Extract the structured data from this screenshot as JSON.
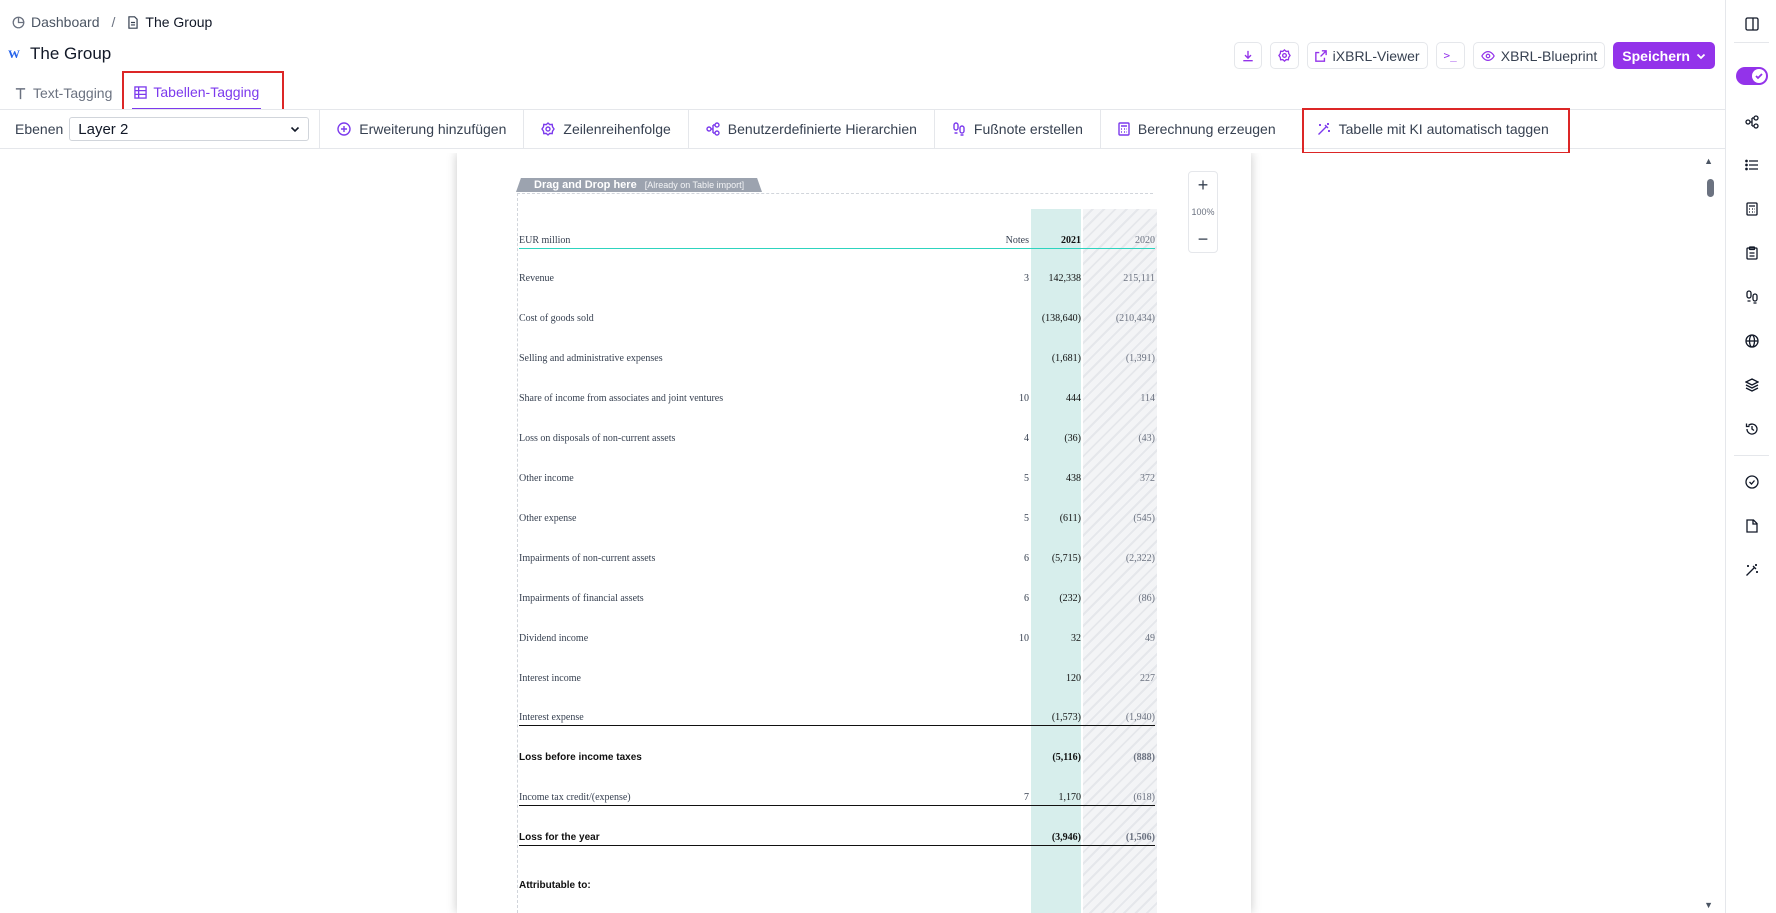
{
  "breadcrumb": {
    "home": "Dashboard",
    "separator": "/",
    "current": "The Group"
  },
  "page": {
    "title": "The Group"
  },
  "tabs": [
    {
      "label": "Text-Tagging",
      "active": false
    },
    {
      "label": "Tabellen-Tagging",
      "active": true
    }
  ],
  "header_actions": {
    "ixbrl_viewer": "iXBRL-Viewer",
    "terminal": ">_",
    "xbrl_blueprint": "XBRL-Blueprint",
    "save": "Speichern"
  },
  "toolbar": {
    "layers_label": "Ebenen",
    "layer_value": "Layer 2",
    "items": [
      {
        "label": "Erweiterung hinzufügen",
        "icon": "plus-circle-icon"
      },
      {
        "label": "Zeilenreihenfolge",
        "icon": "order-icon"
      },
      {
        "label": "Benutzerdefinierte Hierarchien",
        "icon": "hierarchy-icon"
      },
      {
        "label": "Fußnote erstellen",
        "icon": "footnote-icon"
      },
      {
        "label": "Berechnung erzeugen",
        "icon": "calculator-icon"
      },
      {
        "label": "Tabelle mit KI automatisch taggen",
        "icon": "magic-wand-icon"
      }
    ]
  },
  "document": {
    "drag_drop": "Drag and Drop here",
    "drag_drop_sub": "[Already on Table import]",
    "header": {
      "label": "EUR million",
      "notes": "Notes",
      "col1": "2021",
      "col2": "2020"
    },
    "rows": [
      {
        "label": "Revenue",
        "notes": "3",
        "v2021": "142,338",
        "v2020": "215,111",
        "bold": false,
        "line": false
      },
      {
        "label": "Cost of goods sold",
        "notes": "",
        "v2021": "(138,640)",
        "v2020": "(210,434)",
        "bold": false,
        "line": false
      },
      {
        "label": "Selling and administrative expenses",
        "notes": "",
        "v2021": "(1,681)",
        "v2020": "(1,391)",
        "bold": false,
        "line": false
      },
      {
        "label": "Share of income from associates and joint ventures",
        "notes": "10",
        "v2021": "444",
        "v2020": "114",
        "bold": false,
        "line": false
      },
      {
        "label": "Loss on disposals of non-current assets",
        "notes": "4",
        "v2021": "(36)",
        "v2020": "(43)",
        "bold": false,
        "line": false
      },
      {
        "label": "Other income",
        "notes": "5",
        "v2021": "438",
        "v2020": "372",
        "bold": false,
        "line": false
      },
      {
        "label": "Other expense",
        "notes": "5",
        "v2021": "(611)",
        "v2020": "(545)",
        "bold": false,
        "line": false
      },
      {
        "label": "Impairments of non-current assets",
        "notes": "6",
        "v2021": "(5,715)",
        "v2020": "(2,322)",
        "bold": false,
        "line": false
      },
      {
        "label": "Impairments of financial assets",
        "notes": "6",
        "v2021": "(232)",
        "v2020": "(86)",
        "bold": false,
        "line": false
      },
      {
        "label": "Dividend income",
        "notes": "10",
        "v2021": "32",
        "v2020": "49",
        "bold": false,
        "line": false
      },
      {
        "label": "Interest income",
        "notes": "",
        "v2021": "120",
        "v2020": "227",
        "bold": false,
        "line": false
      },
      {
        "label": "Interest expense",
        "notes": "",
        "v2021": "(1,573)",
        "v2020": "(1,940)",
        "bold": false,
        "line": true
      },
      {
        "label": "Loss before income taxes",
        "notes": "",
        "v2021": "(5,116)",
        "v2020": "(888)",
        "bold": true,
        "line": false
      },
      {
        "label": "Income tax credit/(expense)",
        "notes": "7",
        "v2021": "1,170",
        "v2020": "(618)",
        "bold": false,
        "line": true
      },
      {
        "label": "Loss for the year",
        "notes": "",
        "v2021": "(3,946)",
        "v2020": "(1,506)",
        "bold": true,
        "line": true
      },
      {
        "label": "Attributable to:",
        "notes": "",
        "v2021": "",
        "v2020": "",
        "bold": true,
        "line": false
      }
    ]
  },
  "zoom": {
    "plus": "+",
    "level": "100%",
    "minus": "−"
  },
  "colors": {
    "accent": "#9333ea",
    "highlight_column": "#d7eeec",
    "annotation": "#dc2626"
  }
}
